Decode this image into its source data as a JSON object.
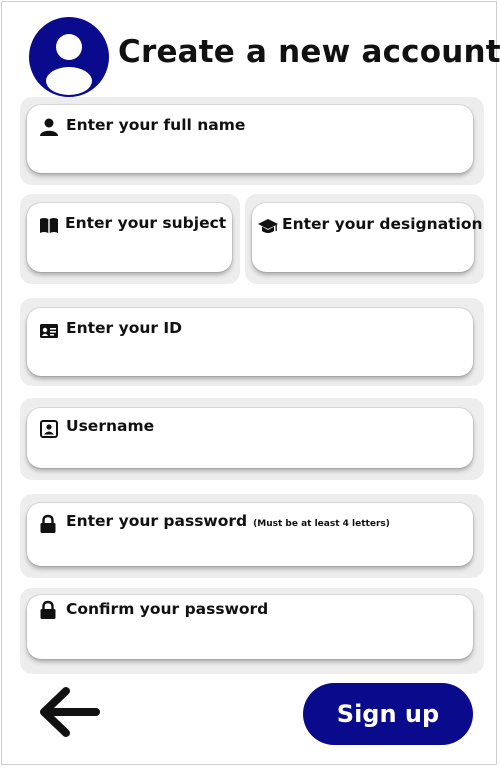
{
  "header": {
    "title": "Create a new account",
    "avatar_icon": "user-avatar-icon"
  },
  "fields": {
    "full_name": {
      "label": "Enter your full name",
      "icon": "user-icon",
      "value": ""
    },
    "subject": {
      "label": "Enter your subject",
      "icon": "book-icon",
      "value": ""
    },
    "designation": {
      "label": "Enter your designation",
      "icon": "graduation-cap-icon",
      "value": ""
    },
    "id": {
      "label": "Enter your ID",
      "icon": "id-card-icon",
      "value": ""
    },
    "username": {
      "label": "Username",
      "icon": "user-square-icon",
      "value": ""
    },
    "password": {
      "label": "Enter your password",
      "note": "(Must be at least 4 letters)",
      "icon": "lock-icon",
      "value": ""
    },
    "confirm_password": {
      "label": "Confirm your password",
      "icon": "lock-icon",
      "value": ""
    }
  },
  "footer": {
    "back_icon": "arrow-left-icon",
    "signup_label": "Sign up"
  },
  "colors": {
    "primary": "#0a0a8c",
    "group_bg": "#ededed",
    "text": "#111111"
  }
}
